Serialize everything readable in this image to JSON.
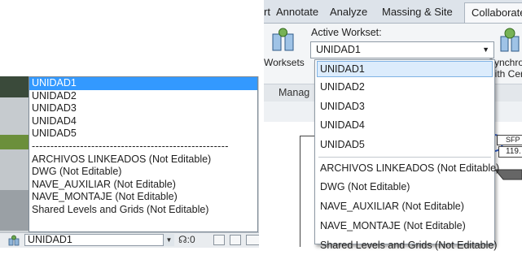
{
  "left": {
    "dropdown_options": [
      "UNIDAD1",
      "UNIDAD2",
      "UNIDAD3",
      "UNIDAD4",
      "UNIDAD5"
    ],
    "separator": "-----------------------------------------------------",
    "dropdown_options_non_editable": [
      "ARCHIVOS LINKEADOS (Not Editable)",
      "DWG (Not Editable)",
      "NAVE_AUXILIAR (Not Editable)",
      "NAVE_MONTAJE (Not Editable)",
      "Shared Levels and Grids (Not Editable)"
    ],
    "selected": "UNIDAD1",
    "statusbar": {
      "active_workset": "UNIDAD1",
      "editable_count": ":0"
    }
  },
  "right": {
    "tabs": [
      "rt",
      "Annotate",
      "Analyze",
      "Massing & Site",
      "Collaborate"
    ],
    "active_tab": "Collaborate",
    "active_workset_label": "Active Workset:",
    "active_workset_value": "UNIDAD1",
    "worksets_button": "Worksets",
    "synchronize_label_line1": "Synchron",
    "synchronize_label_line2": "with Cer",
    "panel_label": "Manag",
    "dropdown_options": [
      "UNIDAD1",
      "UNIDAD2",
      "UNIDAD3",
      "UNIDAD4",
      "UNIDAD5"
    ],
    "dropdown_options_non_editable": [
      "ARCHIVOS LINKEADOS (Not Editable)",
      "DWG (Not Editable)",
      "NAVE_AUXILIAR (Not Editable)",
      "NAVE_MONTAJE (Not Editable)",
      "Shared Levels and Grids (Not Editable)"
    ],
    "view_tag_1": "SFP",
    "view_tag_2": "119."
  },
  "colors": {
    "selection_blue": "#3399ff",
    "ribbon_bg": "#dde3ea",
    "hover_highlight": "#dcecfc"
  }
}
